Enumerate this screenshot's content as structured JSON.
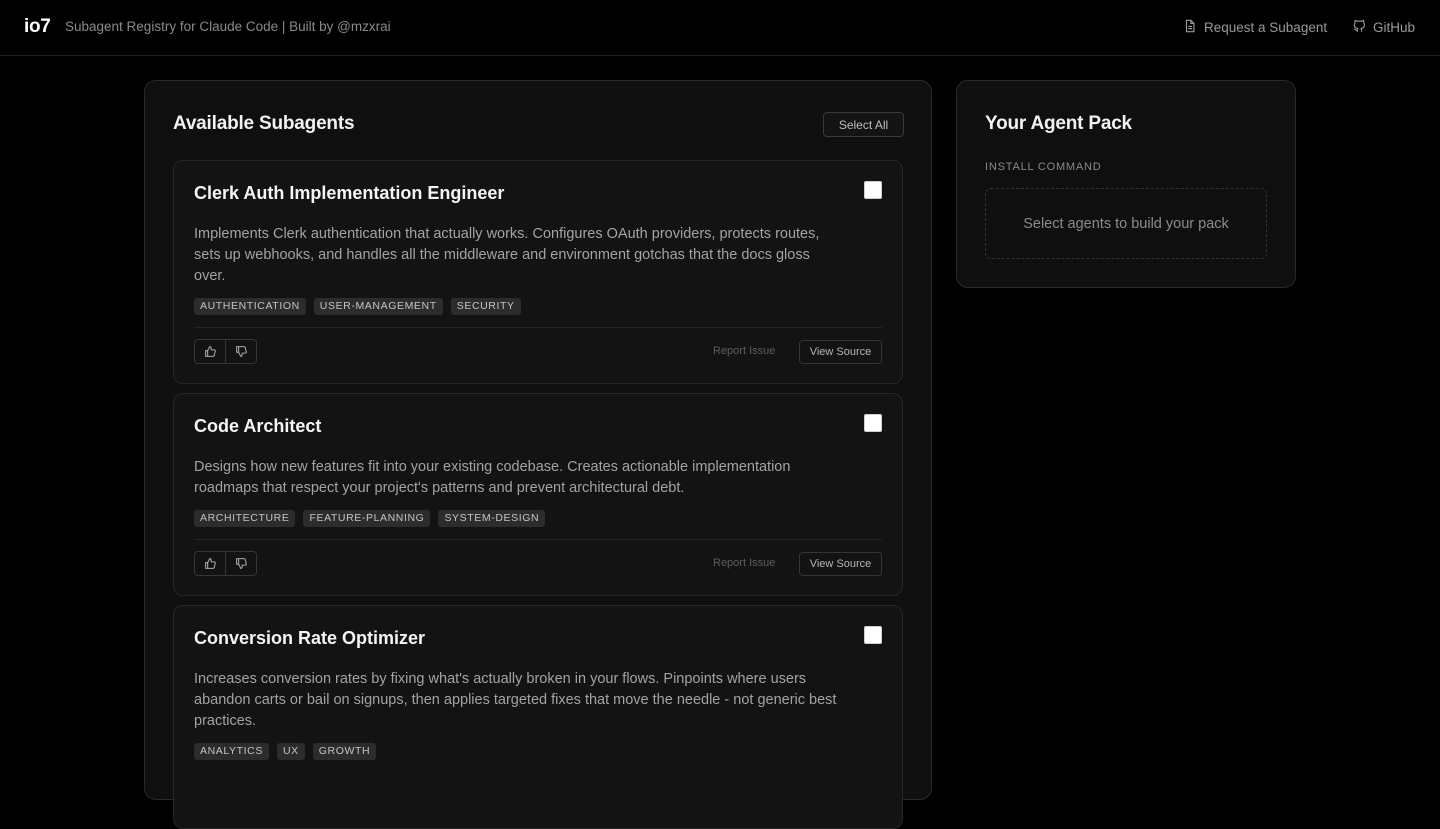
{
  "header": {
    "brand": "io7",
    "tagline": "Subagent Registry for Claude Code | Built by @mzxrai",
    "request_label": "Request a Subagent",
    "github_label": "GitHub"
  },
  "subagents_panel": {
    "title": "Available Subagents",
    "select_all_label": "Select All",
    "cards": [
      {
        "title": "Clerk Auth Implementation Engineer",
        "description": "Implements Clerk authentication that actually works. Configures OAuth providers, protects routes, sets up webhooks, and handles all the middleware and environment gotchas that the docs gloss over.",
        "tags": [
          "AUTHENTICATION",
          "USER-MANAGEMENT",
          "SECURITY"
        ],
        "report_label": "Report Issue",
        "view_source_label": "View Source",
        "checked": false
      },
      {
        "title": "Code Architect",
        "description": "Designs how new features fit into your existing codebase. Creates actionable implementation roadmaps that respect your project's patterns and prevent architectural debt.",
        "tags": [
          "ARCHITECTURE",
          "FEATURE-PLANNING",
          "SYSTEM-DESIGN"
        ],
        "report_label": "Report Issue",
        "view_source_label": "View Source",
        "checked": false
      },
      {
        "title": "Conversion Rate Optimizer",
        "description": "Increases conversion rates by fixing what's actually broken in your flows. Pinpoints where users abandon carts or bail on signups, then applies targeted fixes that move the needle - not generic best practices.",
        "tags": [
          "ANALYTICS",
          "UX",
          "GROWTH"
        ],
        "checked": false
      }
    ]
  },
  "pack_panel": {
    "title": "Your Agent Pack",
    "install_label": "INSTALL COMMAND",
    "empty_message": "Select agents to build your pack"
  }
}
